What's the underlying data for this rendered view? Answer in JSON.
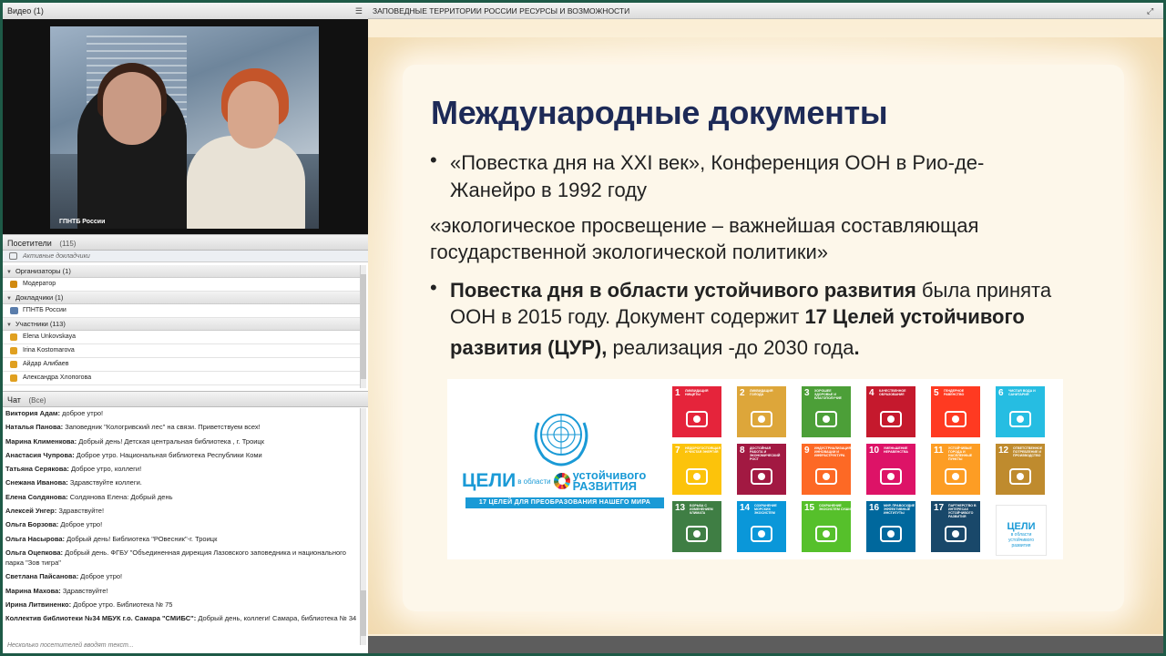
{
  "video_panel": {
    "title": "Видео",
    "count": "(1)",
    "watermark": "ГПНТБ России"
  },
  "visitors": {
    "title": "Посетители",
    "count": "(115)",
    "active_speakers": "Активные докладчики",
    "groups": [
      {
        "label": "Организаторы (1)",
        "members": [
          "Модератор"
        ]
      },
      {
        "label": "Докладчики (1)",
        "members": [
          "ГПНТБ России"
        ]
      },
      {
        "label": "Участники (113)",
        "members": [
          "Elena Unkovskaya",
          "Irina Kostomarova",
          "Айдар Алибаев",
          "Александра Хлопогова"
        ]
      }
    ]
  },
  "chat": {
    "title": "Чат",
    "scope": "(Все)",
    "messages": [
      {
        "author": "Виктория Адам:",
        "text": "доброе утро!"
      },
      {
        "author": "Наталья Панова:",
        "text": "Заповедник \"Кологривский лес\" на связи. Приветствуем всех!"
      },
      {
        "author": "Марина  Клименкова:",
        "text": "Добрый день! Детская центральная библиотека , г. Троицк"
      },
      {
        "author": "Анастасия Чупрова:",
        "text": "Доброе утро. Национальная библиотека Республики Коми"
      },
      {
        "author": "Татьяна Серякова:",
        "text": "Доброе утро, коллеги!"
      },
      {
        "author": "Снежана Иванова:",
        "text": "Здравствуйте коллеги."
      },
      {
        "author": "Елена Солдянова:",
        "text": "Солдянова Елена: Добрый день"
      },
      {
        "author": "Алексей Унгер:",
        "text": "Здравствуйте!"
      },
      {
        "author": "Ольга Борзова:",
        "text": "Доброе утро!"
      },
      {
        "author": "Ольга Насырова:",
        "text": "Добрый день! Библиотека \"РОвесник\"-г. Троицк"
      },
      {
        "author": "Ольга Оцепкова:",
        "text": "Добрый день. ФГБУ \"Объединенная дирекция Лазовского заповедника и национального парка \"Зов тигра\""
      },
      {
        "author": "Светлана Пайсанова:",
        "text": "Доброе утро!"
      },
      {
        "author": "Марина Махова:",
        "text": "Здравствуйте!"
      },
      {
        "author": "Ирина Литвиненко:",
        "text": "Доброе утро. Библиотека № 75"
      },
      {
        "author": "Коллектив библиотеки №34 МБУК г.о. Самара \"СМИБС\":",
        "text": "Добрый день, коллеги! Самара, библиотека № 34"
      }
    ],
    "typing": "Несколько посетителей вводят текст..."
  },
  "presentation": {
    "title": "ЗАПОВЕДНЫЕ ТЕРРИТОРИИ РОССИИ РЕСУРСЫ И ВОЗМОЖНОСТИ"
  },
  "slide": {
    "heading": "Международные документы",
    "bullet1_line1": "«Повестка дня на XXI век», Конференция ООН в Рио-де-",
    "bullet1_line2": "Жанейро в 1992 году",
    "quote_line1": "«экологическое просвещение – важнейшая составляющая",
    "quote_line2": "государственной экологической политики»",
    "bullet2_bold1": "Повестка дня в области устойчивого развития",
    "bullet2_text1": " была принята",
    "bullet2_line2a": "ООН в 2015 году. Документ содержит ",
    "bullet2_bold2": "17 Целей устойчивого",
    "bullet2_bold3": "развития (ЦУР),",
    "bullet2_text3": " реализация -до 2030 года",
    "bullet2_end": "."
  },
  "sdg": {
    "celi": "ЦЕЛИ",
    "v_oblasti": "в области",
    "ustoichivogo": "устойчивого",
    "razvitiya": "развития",
    "bar": "17 ЦЕЛЕЙ ДЛЯ ПРЕОБРАЗОВАНИЯ НАШЕГО МИРА",
    "logo_title": "ЦЕЛИ",
    "logo_sub1": "в области",
    "logo_sub2": "устойчивого",
    "logo_sub3": "развития",
    "goals": [
      {
        "num": "1",
        "label": "ЛИКВИДАЦИЯ НИЩЕТЫ",
        "color": "#e5243b"
      },
      {
        "num": "2",
        "label": "ЛИКВИДАЦИЯ ГОЛОДА",
        "color": "#dda63a"
      },
      {
        "num": "3",
        "label": "ХОРОШЕЕ ЗДОРОВЬЕ И БЛАГОПОЛУЧИЕ",
        "color": "#4c9f38"
      },
      {
        "num": "4",
        "label": "КАЧЕСТВЕННОЕ ОБРАЗОВАНИЕ",
        "color": "#c5192d"
      },
      {
        "num": "5",
        "label": "ГЕНДЕРНОЕ РАВЕНСТВО",
        "color": "#ff3a21"
      },
      {
        "num": "6",
        "label": "ЧИСТАЯ ВОДА И САНИТАРИЯ",
        "color": "#26bde2"
      },
      {
        "num": "7",
        "label": "НЕДОРОГОСТОЯЩАЯ И ЧИСТАЯ ЭНЕРГИЯ",
        "color": "#fcc30b"
      },
      {
        "num": "8",
        "label": "ДОСТОЙНАЯ РАБОТА И ЭКОНОМИЧЕСКИЙ РОСТ",
        "color": "#a21942"
      },
      {
        "num": "9",
        "label": "ИНДУСТРИАЛИЗАЦИЯ, ИННОВАЦИИ И ИНФРАСТРУКТУРА",
        "color": "#fd6925"
      },
      {
        "num": "10",
        "label": "УМЕНЬШЕНИЕ НЕРАВЕНСТВА",
        "color": "#dd1367"
      },
      {
        "num": "11",
        "label": "УСТОЙЧИВЫЕ ГОРОДА И НАСЕЛЕННЫЕ ПУНКТЫ",
        "color": "#fd9d24"
      },
      {
        "num": "12",
        "label": "ОТВЕТСТВЕННОЕ ПОТРЕБЛЕНИЕ И ПРОИЗВОДСТВО",
        "color": "#bf8b2e"
      },
      {
        "num": "13",
        "label": "БОРЬБА С ИЗМЕНЕНИЕМ КЛИМАТА",
        "color": "#3f7e44"
      },
      {
        "num": "14",
        "label": "СОХРАНЕНИЕ МОРСКИХ ЭКОСИСТЕМ",
        "color": "#0a97d9"
      },
      {
        "num": "15",
        "label": "СОХРАНЕНИЕ ЭКОСИСТЕМ СУШИ",
        "color": "#56c02b"
      },
      {
        "num": "16",
        "label": "МИР, ПРАВОСУДИЕ И ЭФФЕКТИВНЫЕ ИНСТИТУТЫ",
        "color": "#00689d"
      },
      {
        "num": "17",
        "label": "ПАРТНЕРСТВО В ИНТЕРЕСАХ УСТОЙЧИВОГО РАЗВИТИЯ",
        "color": "#19486a"
      }
    ]
  }
}
